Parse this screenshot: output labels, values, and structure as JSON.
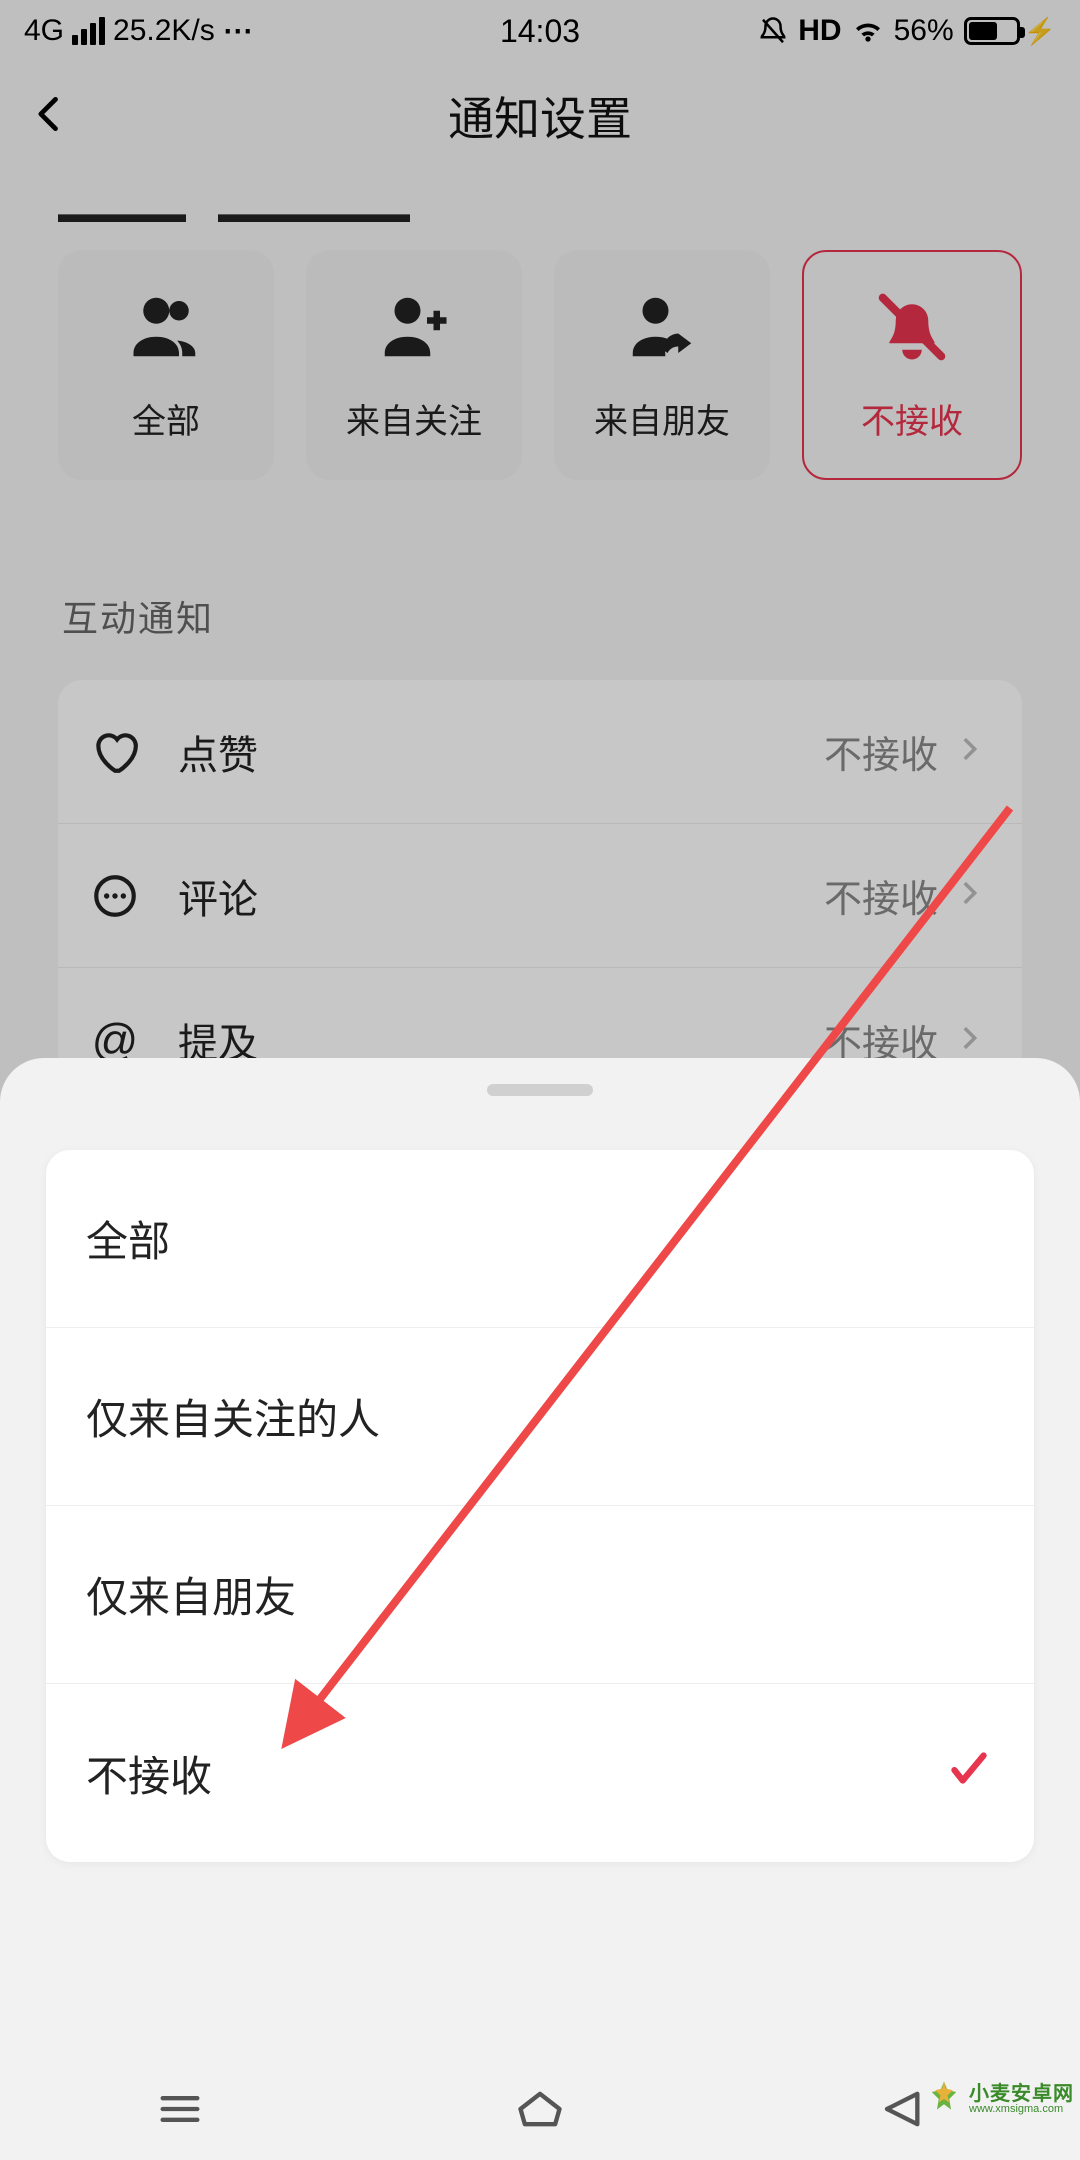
{
  "status": {
    "network": "4G",
    "speed": "25.2K/s",
    "time": "14:03",
    "hd": "HD",
    "battery_pct": "56%"
  },
  "header": {
    "title": "通知设置"
  },
  "filters": {
    "items": [
      {
        "label": "全部",
        "icon": "users"
      },
      {
        "label": "来自关注",
        "icon": "user-plus"
      },
      {
        "label": "来自朋友",
        "icon": "user-sync"
      },
      {
        "label": "不接收",
        "icon": "bell-off",
        "selected": true
      }
    ]
  },
  "section": {
    "title": "互动通知",
    "rows": [
      {
        "icon": "heart",
        "label": "点赞",
        "value": "不接收"
      },
      {
        "icon": "comment",
        "label": "评论",
        "value": "不接收"
      },
      {
        "icon": "at",
        "label": "提及",
        "value": "不接收"
      }
    ]
  },
  "sheet": {
    "options": [
      {
        "label": "全部"
      },
      {
        "label": "仅来自关注的人"
      },
      {
        "label": "仅来自朋友"
      },
      {
        "label": "不接收",
        "selected": true
      }
    ]
  },
  "watermark": {
    "cn": "小麦安卓网",
    "en": "www.xmsigma.com"
  }
}
